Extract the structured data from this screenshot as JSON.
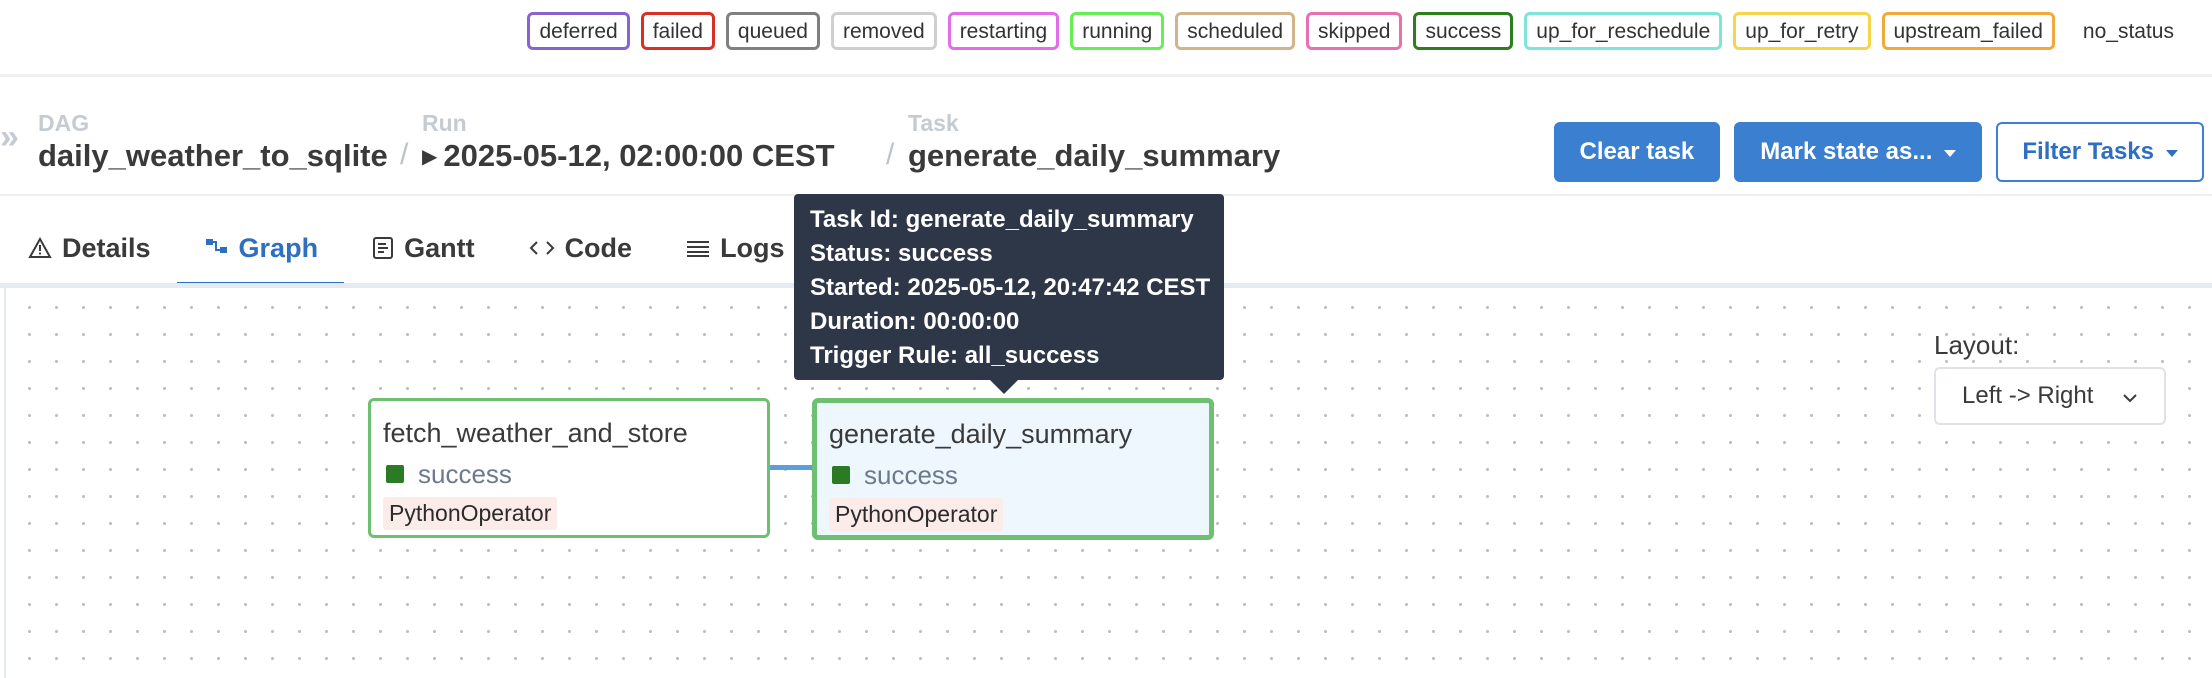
{
  "legend": {
    "items": [
      {
        "label": "deferred",
        "color": "#8a63d2"
      },
      {
        "label": "failed",
        "color": "#d93025"
      },
      {
        "label": "queued",
        "color": "#808080"
      },
      {
        "label": "removed",
        "color": "#cfcfcf"
      },
      {
        "label": "restarting",
        "color": "#e26de8"
      },
      {
        "label": "running",
        "color": "#66ee55"
      },
      {
        "label": "scheduled",
        "color": "#d2b48c"
      },
      {
        "label": "skipped",
        "color": "#e870ae"
      },
      {
        "label": "success",
        "color": "#2e7d1f"
      },
      {
        "label": "up_for_reschedule",
        "color": "#7ee6d8"
      },
      {
        "label": "up_for_retry",
        "color": "#f7d54a"
      },
      {
        "label": "upstream_failed",
        "color": "#f0a93a"
      },
      {
        "label": "no_status",
        "color": "transparent"
      }
    ]
  },
  "breadcrumb": {
    "arrow_icon": "double-chevron-right-icon",
    "dag_label": "DAG",
    "dag_value": "daily_weather_to_sqlite",
    "run_label": "Run",
    "run_value": "2025-05-12, 02:00:00 CEST",
    "task_label": "Task",
    "task_value": "generate_daily_summary",
    "separator": "/"
  },
  "actions": {
    "clear_task": "Clear task",
    "mark_state": "Mark state as...",
    "filter_tasks": "Filter Tasks"
  },
  "tabs": [
    {
      "label": "Details",
      "icon": "warning-triangle-icon",
      "active": false
    },
    {
      "label": "Graph",
      "icon": "graph-icon",
      "active": true
    },
    {
      "label": "Gantt",
      "icon": "gantt-icon",
      "active": false
    },
    {
      "label": "Code",
      "icon": "code-icon",
      "active": false
    },
    {
      "label": "Logs",
      "icon": "list-icon",
      "active": false
    }
  ],
  "graph": {
    "nodes": [
      {
        "title": "fetch_weather_and_store",
        "status": "success",
        "operator": "PythonOperator"
      },
      {
        "title": "generate_daily_summary",
        "status": "success",
        "operator": "PythonOperator",
        "selected": true
      }
    ],
    "status_color": "#2b7a24",
    "layout_label": "Layout:",
    "layout_value": "Left -> Right"
  },
  "tooltip": {
    "task_id": "Task Id: generate_daily_summary",
    "status": "Status: success",
    "started": "Started: 2025-05-12, 20:47:42 CEST",
    "duration": "Duration: 00:00:00",
    "trigger_rule": "Trigger Rule: all_success"
  },
  "colors": {
    "primary": "#3b7fd1",
    "success_border": "#6fbf73",
    "edge": "#5b9ee0"
  }
}
